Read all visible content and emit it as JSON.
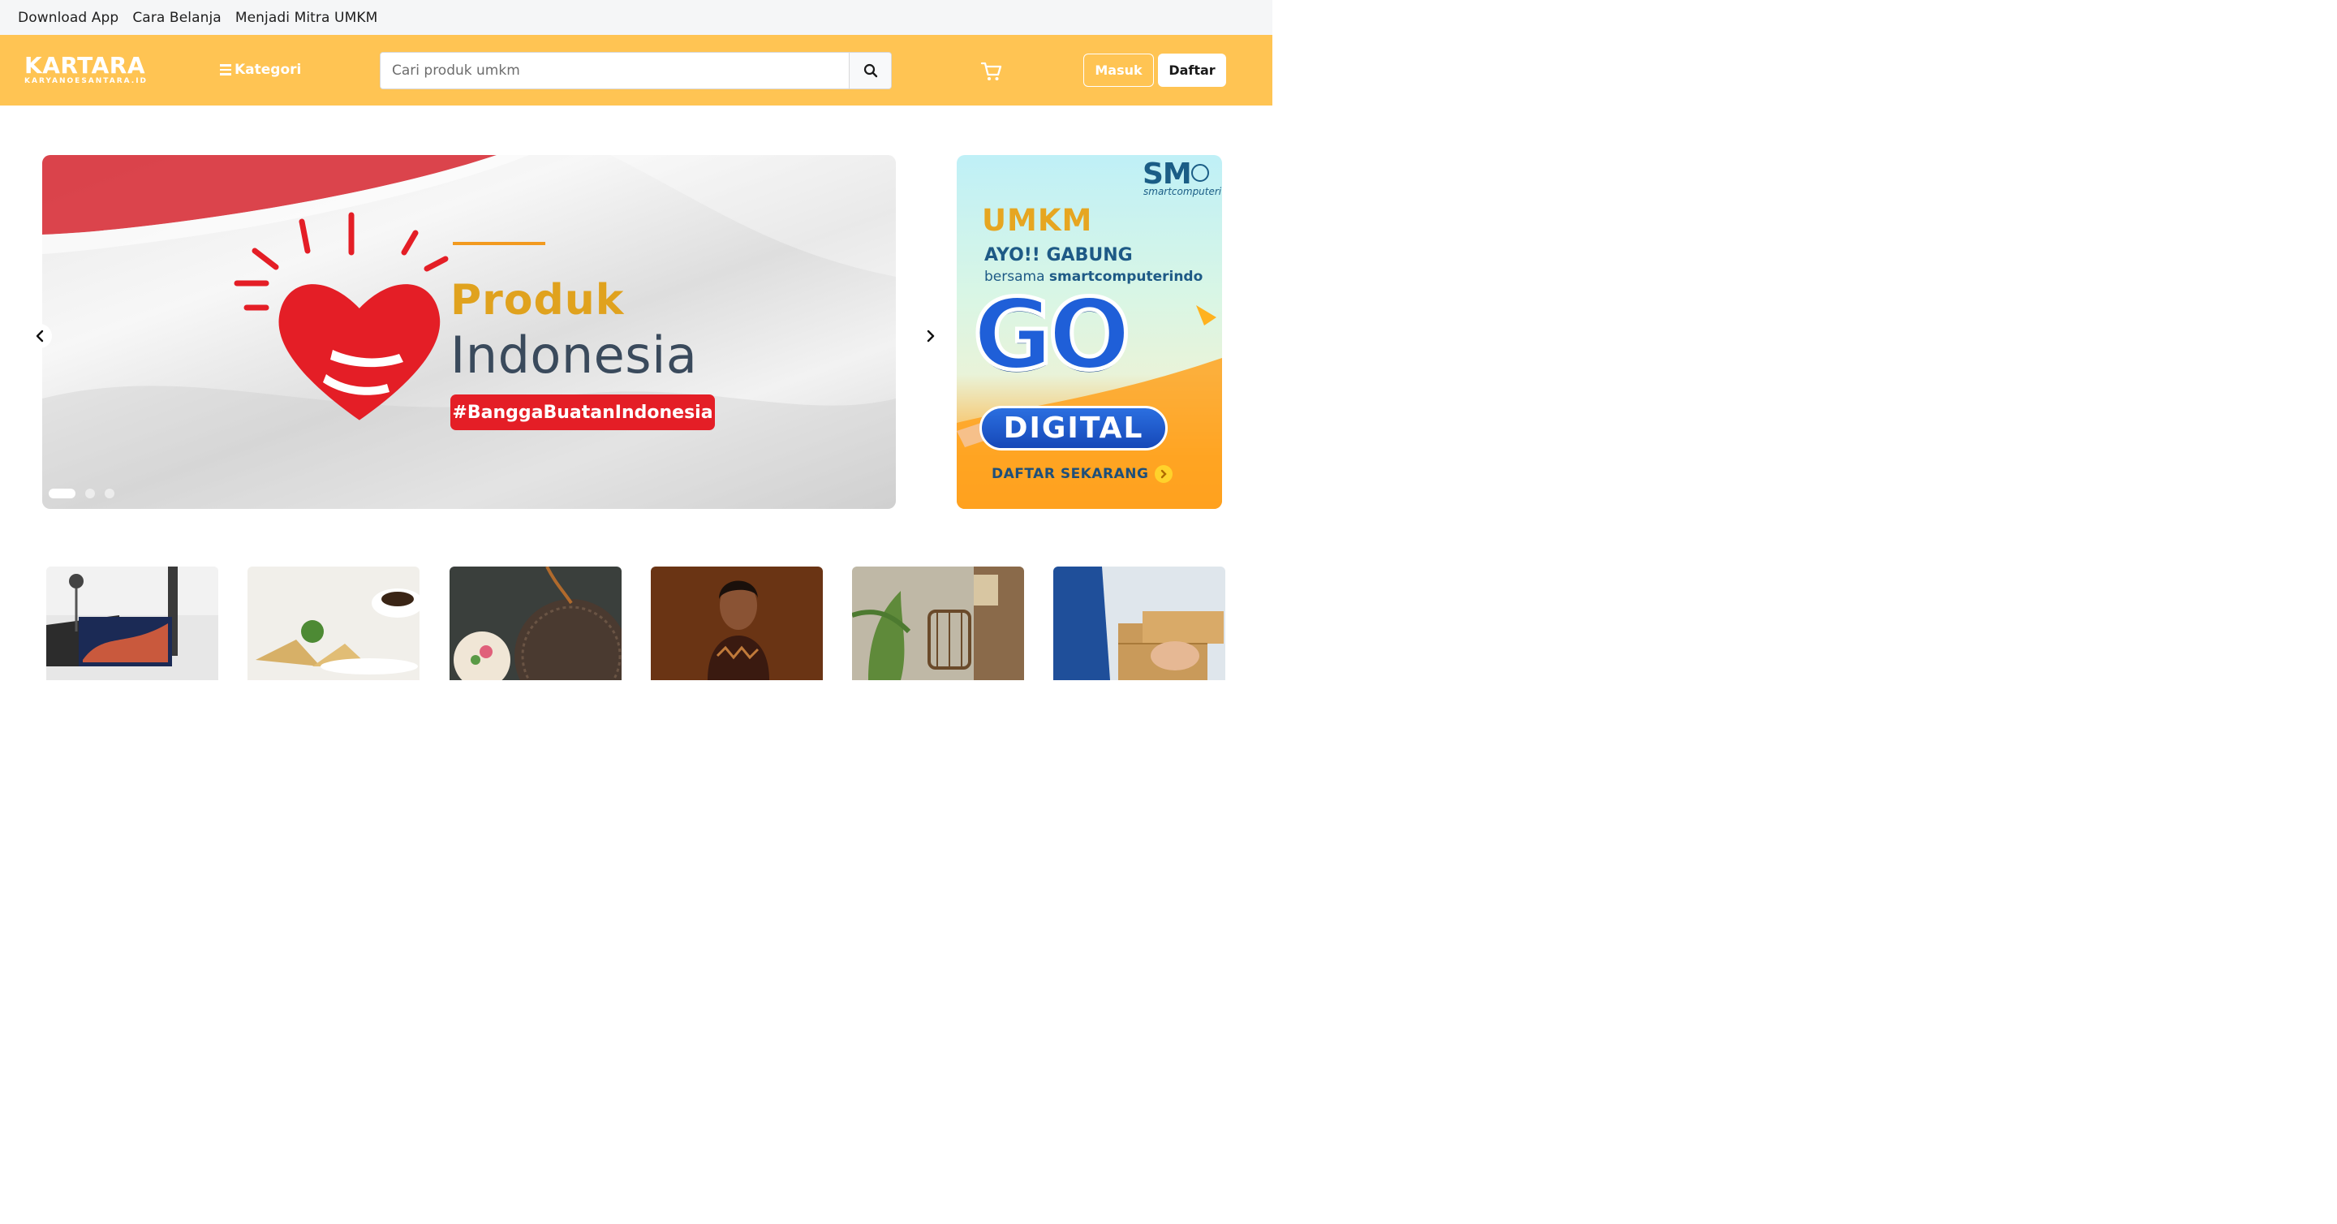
{
  "topbar": {
    "links": [
      "Download App",
      "Cara Belanja",
      "Menjadi Mitra UMKM"
    ]
  },
  "header": {
    "logo_main": "KARTARA",
    "logo_sub": "KARYANOESANTARA.ID",
    "kategori_label": "Kategori",
    "search_placeholder": "Cari produk umkm",
    "masuk_label": "Masuk",
    "daftar_label": "Daftar",
    "accent_color": "#ffc453"
  },
  "carousel": {
    "slide_title_1": "Produk",
    "slide_title_2": "Indonesia",
    "hashtag": "#BanggaBuatanIndonesia",
    "dot_count": 3,
    "active_dot": 0
  },
  "side_banner": {
    "logo": "SM",
    "logo_sub": "smartcomputeri",
    "headline": "UMKM",
    "line1": "AYO!! GABUNG",
    "line2_prefix": "bersama",
    "line2_brand": "smartcomputerindo",
    "go": "GO",
    "digital": "DIGITAL",
    "cta": "DAFTAR SEKARANG"
  },
  "categories": [
    {
      "icon": "laptop-image"
    },
    {
      "icon": "food-image"
    },
    {
      "icon": "rattan-bag-image"
    },
    {
      "icon": "batik-fashion-image"
    },
    {
      "icon": "home-decor-image"
    },
    {
      "icon": "delivery-box-image"
    }
  ]
}
